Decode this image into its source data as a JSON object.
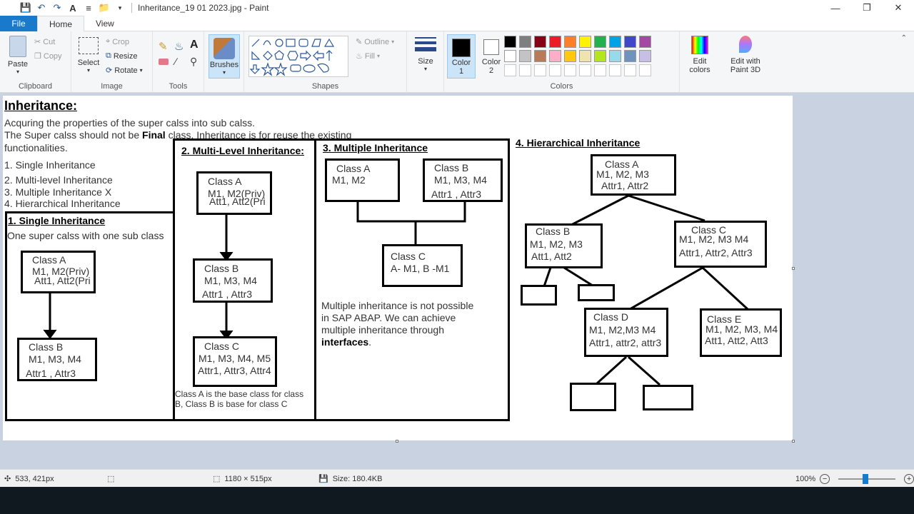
{
  "window": {
    "title": "Inheritance_19 01 2023.jpg - Paint",
    "minimize": "—",
    "maximize": "❐",
    "close": "✕"
  },
  "tabs": [
    {
      "label": "File"
    },
    {
      "label": "Home"
    },
    {
      "label": "View"
    }
  ],
  "ribbon": {
    "clipboard": {
      "label": "Clipboard",
      "paste": "Paste",
      "cut": "Cut",
      "copy": "Copy"
    },
    "image": {
      "label": "Image",
      "select": "Select",
      "crop": "Crop",
      "resize": "Resize",
      "rotate": "Rotate"
    },
    "tools": {
      "label": "Tools"
    },
    "brushes": {
      "label": "Brushes"
    },
    "shapes": {
      "label": "Shapes",
      "outline": "Outline",
      "fill": "Fill"
    },
    "size": {
      "label": "Size"
    },
    "colors": {
      "label": "Colors",
      "color1": "Color 1",
      "color2": "Color 2",
      "edit_colors": "Edit colors",
      "edit_paint3d": "Edit with Paint 3D",
      "palette_row1": [
        "#000000",
        "#7f7f7f",
        "#880015",
        "#ed1c24",
        "#ff7f27",
        "#fff200",
        "#22b14c",
        "#00a2e8",
        "#3f48cc",
        "#a349a4"
      ],
      "palette_row2": [
        "#ffffff",
        "#c3c3c3",
        "#b97a57",
        "#ffaec9",
        "#ffc90e",
        "#efe4b0",
        "#b5e61d",
        "#99d9ea",
        "#7092be",
        "#c8bfe7"
      ]
    }
  },
  "canvas": {
    "heading": "Inheritance:",
    "intro": [
      "Acquring the properties of the super calss into sub calss.",
      "functionalities."
    ],
    "intro2_pre": "The Super calss should not be ",
    "intro2_bold": "Final",
    "intro2_post": " class. Inheritance is for reuse the existing",
    "list": [
      "1. Single Inheritance",
      "2. Multi-level Inheritance",
      "3. Multiple Inheritance  X",
      "4. Hierarchical Inheritance"
    ],
    "single": {
      "title": "1. Single Inheritance",
      "desc": "One super calss with one sub class",
      "a": [
        "Class A",
        "M1, M2(Priv)",
        "Att1, Att2(Pri"
      ],
      "b": [
        "Class B",
        "M1, M3, M4",
        "Attr1 , Attr3"
      ]
    },
    "multilevel": {
      "title": "2. Multi-Level Inheritance:",
      "a": [
        "Class A",
        "M1, M2(Priv)",
        "Att1, Att2(Pri"
      ],
      "b": [
        "Class B",
        "M1, M3, M4",
        "Attr1 , Attr3"
      ],
      "c": [
        "Class C",
        "M1, M3, M4, M5",
        "Attr1, Attr3, Attr4"
      ],
      "note": [
        "Class A is the base class for class",
        "B, Class B is base for class C"
      ]
    },
    "multiple": {
      "title": "3. Multiple Inheritance",
      "a": [
        "Class A",
        "M1, M2"
      ],
      "b": [
        "Class B",
        "M1, M3, M4",
        "Attr1 , Attr3"
      ],
      "c": [
        "Class C",
        "A- M1, B -M1"
      ],
      "note": [
        "Multiple inheritance is not possible",
        "in SAP ABAP. We can achieve",
        "multiple inheritance through"
      ],
      "note_bold": "interfaces",
      "note_end": "."
    },
    "hierarchical": {
      "title": "4. Hierarchical Inheritance",
      "a": [
        "Class A",
        "M1, M2, M3",
        "Attr1, Attr2"
      ],
      "b": [
        "Class B",
        "M1, M2, M3",
        "Att1, Att2"
      ],
      "c": [
        "Class C",
        "M1, M2, M3 M4",
        "Attr1, Attr2, Attr3"
      ],
      "d": [
        "Class D",
        "M1, M2,M3 M4",
        "Attr1, attr2, attr3"
      ],
      "e": [
        "Class E",
        "M1, M2, M3, M4",
        "Att1, Att2, Att3"
      ]
    }
  },
  "status": {
    "cursor": "533, 421px",
    "dimensions": "1180 × 515px",
    "size": "Size: 180.4KB",
    "zoom": "100%"
  }
}
